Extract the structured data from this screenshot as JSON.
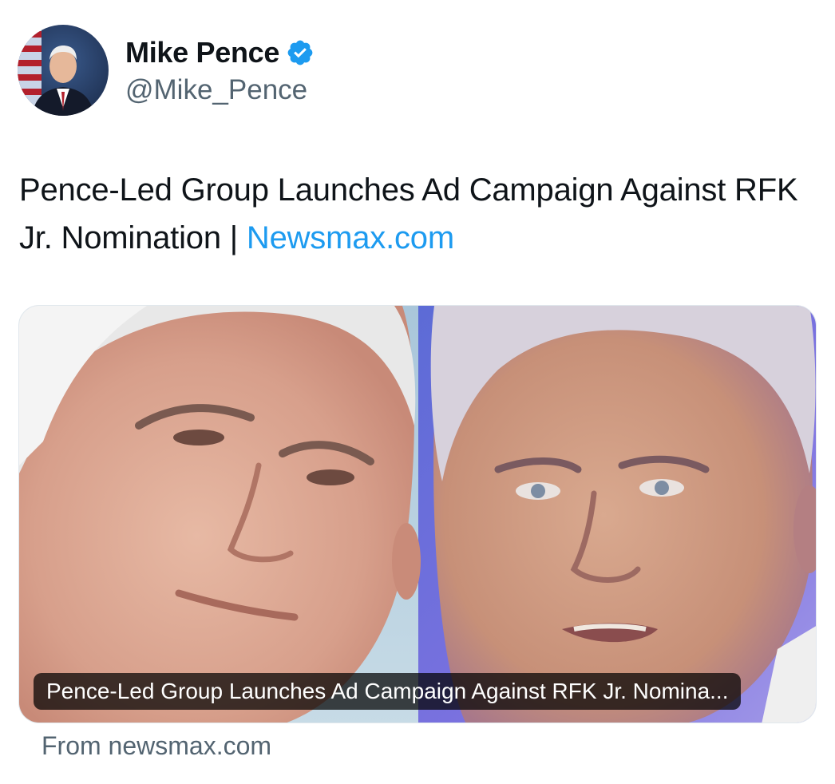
{
  "author": {
    "display_name": "Mike Pence",
    "handle": "@Mike_Pence",
    "verified_icon": "verified-badge-icon",
    "verified_color": "#1d9bf0"
  },
  "tweet": {
    "text": "Pence-Led Group Launches Ad Campaign Against RFK Jr. Nomination | ",
    "link_text": "Newsmax.com",
    "link_color": "#1d9bf0"
  },
  "card": {
    "caption": "Pence-Led Group Launches Ad Campaign Against RFK Jr. Nomina...",
    "source": "From newsmax.com"
  }
}
